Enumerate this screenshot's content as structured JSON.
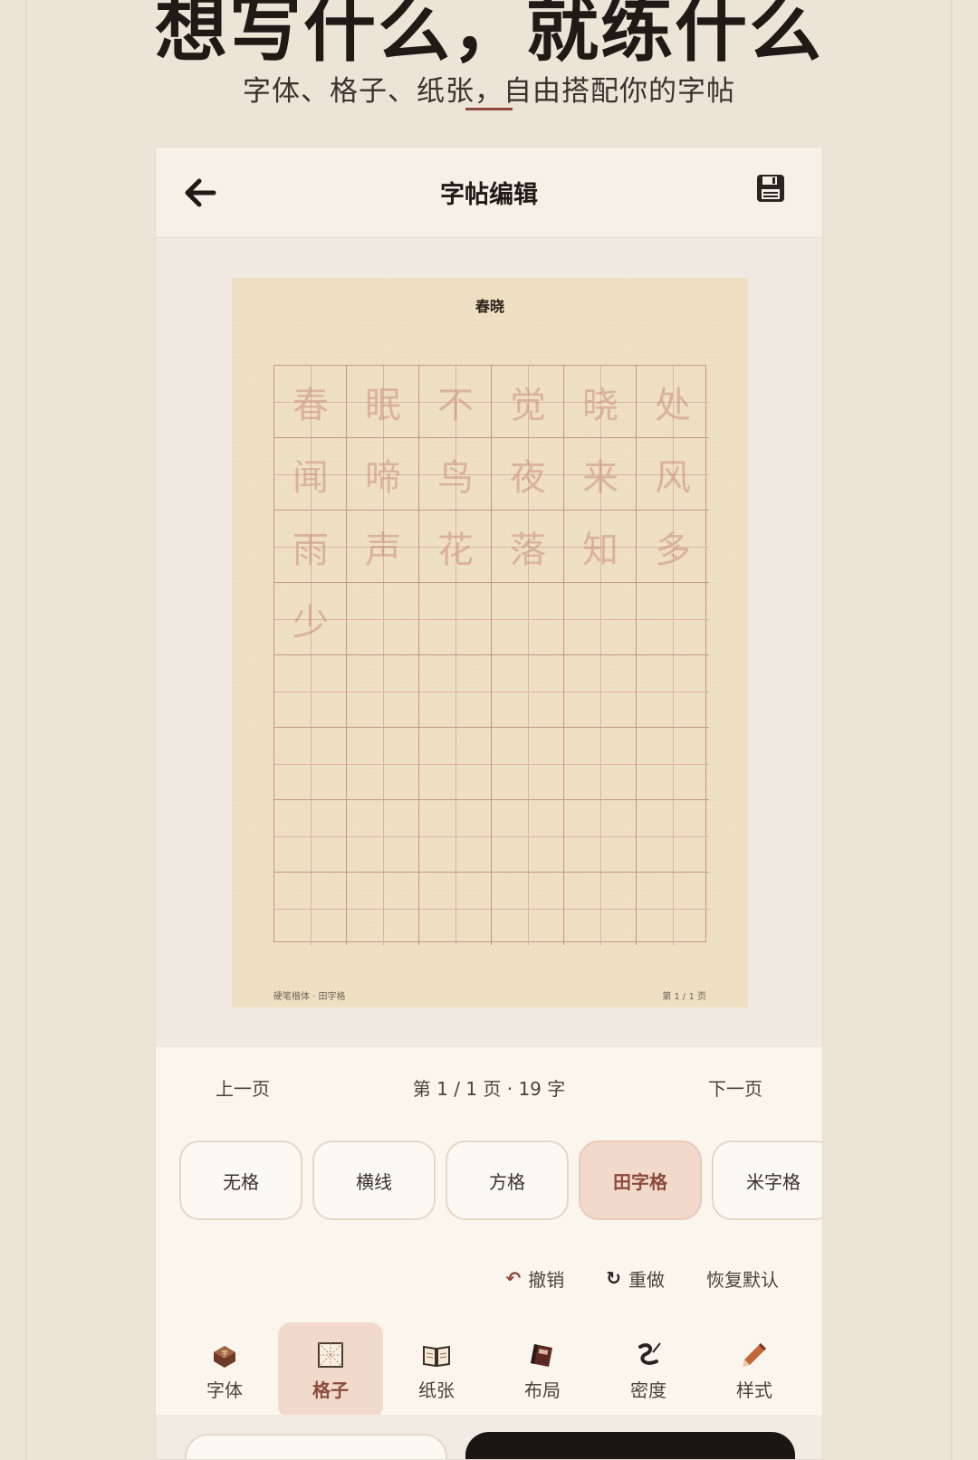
{
  "promo": {
    "headline": "想写什么，就练什么",
    "subheadline": "字体、格子、纸张，自由搭配你的字帖"
  },
  "app": {
    "title": "字帖编辑",
    "back_icon": "arrow-left-icon",
    "save_icon": "floppy-disk-icon"
  },
  "sheet": {
    "title": "春晓",
    "characters": [
      "春",
      "眠",
      "不",
      "觉",
      "晓",
      "处",
      "闻",
      "啼",
      "鸟",
      "夜",
      "来",
      "风",
      "雨",
      "声",
      "花",
      "落",
      "知",
      "多",
      "少"
    ],
    "footer_left": "硬笔楷体 · 田字格",
    "footer_right": "第 1 / 1 页"
  },
  "pager": {
    "prev": "上一页",
    "info": "第 1 / 1 页 · 19 字",
    "next": "下一页"
  },
  "grid_options": [
    {
      "label": "无格",
      "active": false
    },
    {
      "label": "横线",
      "active": false
    },
    {
      "label": "方格",
      "active": false
    },
    {
      "label": "田字格",
      "active": true
    },
    {
      "label": "米字格",
      "active": false
    }
  ],
  "actions": {
    "undo": "撤销",
    "redo": "重做",
    "reset": "恢复默认"
  },
  "tabs": [
    {
      "label": "字体",
      "icon": "ink-block-icon",
      "active": false
    },
    {
      "label": "格子",
      "icon": "grid-icon",
      "active": true
    },
    {
      "label": "纸张",
      "icon": "open-book-icon",
      "active": false
    },
    {
      "label": "布局",
      "icon": "notebook-icon",
      "active": false
    },
    {
      "label": "密度",
      "icon": "brush-stroke-icon",
      "active": false
    },
    {
      "label": "样式",
      "icon": "pencil-icon",
      "active": false
    }
  ],
  "colors": {
    "accent": "#8b4a3a",
    "active_bg": "#f1d9cc",
    "paper": "#efe0c4",
    "grid_line": "#c49686"
  }
}
